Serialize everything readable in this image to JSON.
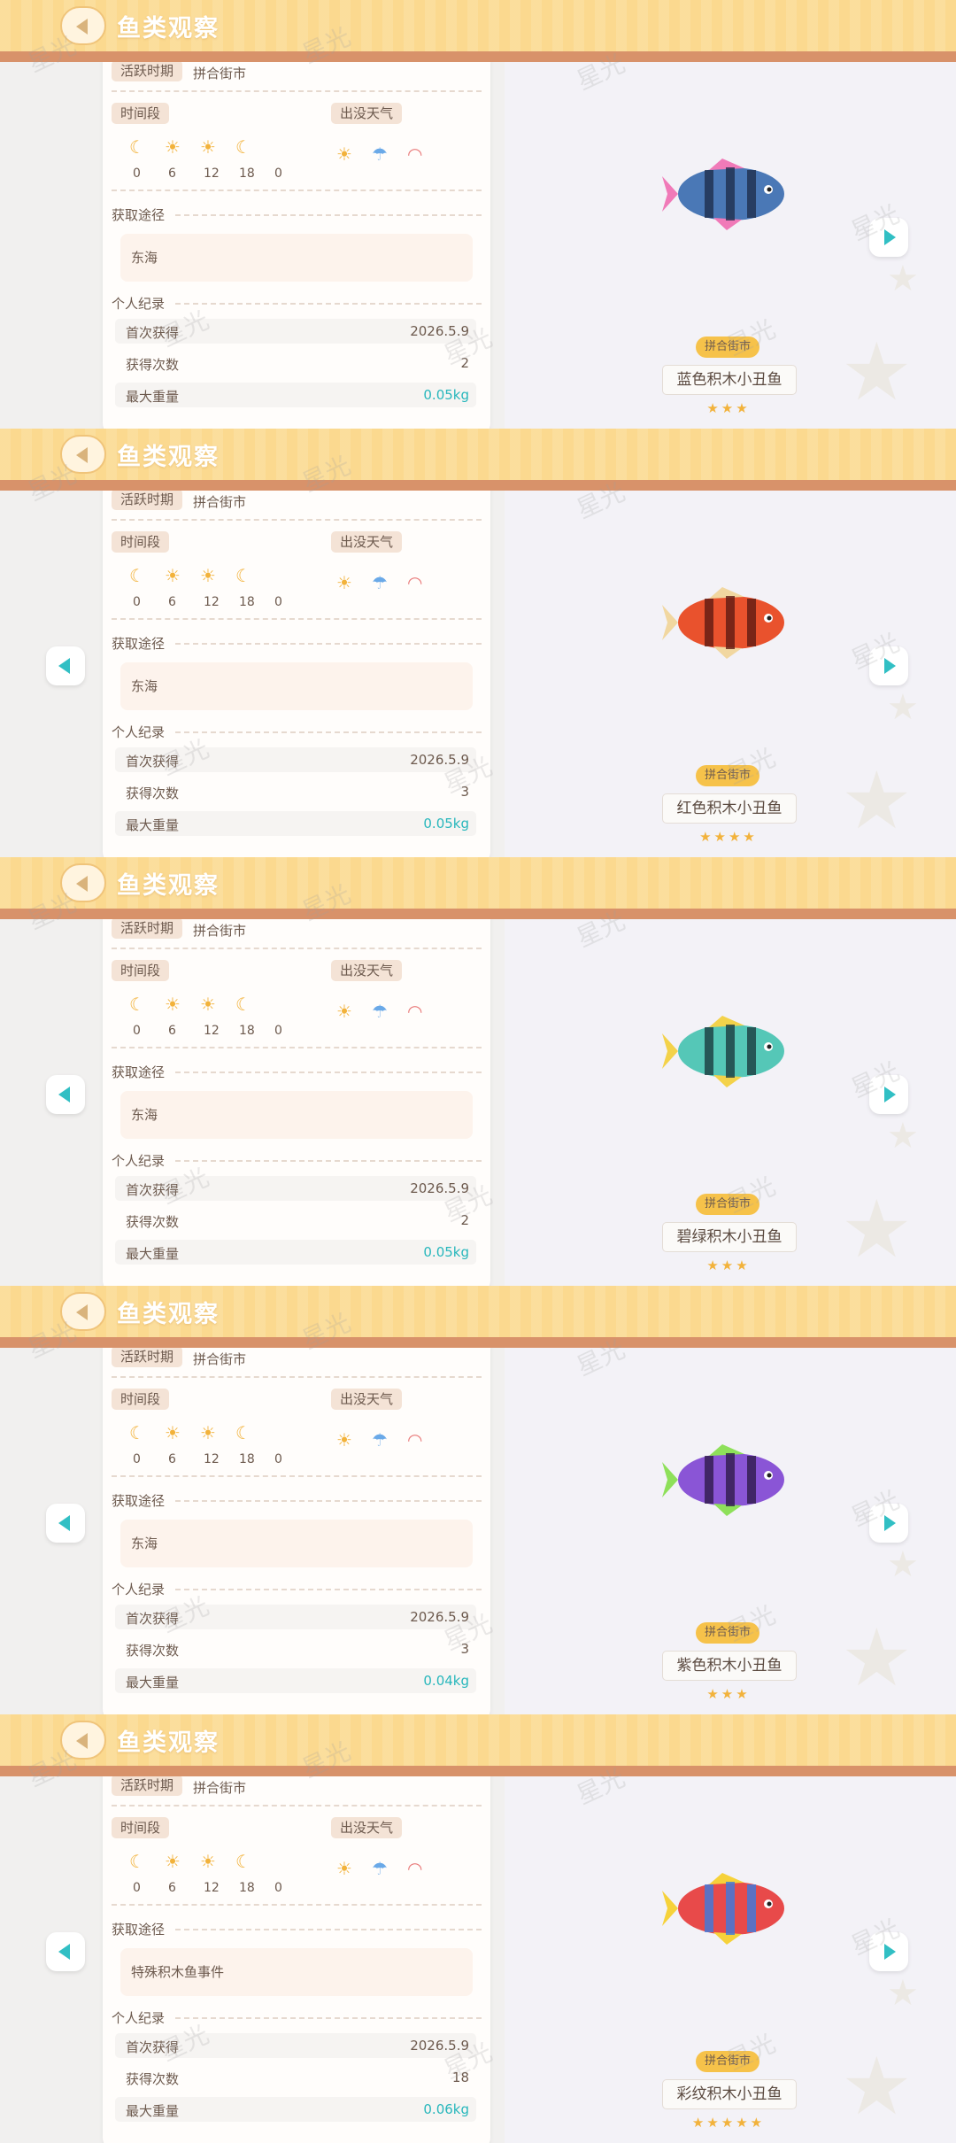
{
  "header": {
    "title": "鱼类观察"
  },
  "labels": {
    "active_period": "活跃时期",
    "time_segment": "时间段",
    "weather": "出没天气",
    "obtain_way": "获取途径",
    "personal_record": "个人纪录",
    "first_obtained": "首次获得",
    "obtain_count": "获得次数",
    "max_weight": "最大重量"
  },
  "time_ticks": [
    "0",
    "6",
    "12",
    "18",
    "0"
  ],
  "time_icons": [
    "moon-icon",
    "sunrise-icon",
    "sun-icon",
    "moon-icon"
  ],
  "weather_icons": [
    "sun-icon",
    "rain-cloud-icon",
    "rainbow-icon"
  ],
  "watermark": "星光",
  "colors": {
    "header": "#fbd98f",
    "stripe": "#d8926a",
    "teal": "#28b7bc",
    "star": "#f2b23b",
    "badge": "#f6c24a"
  },
  "panels": [
    {
      "season": "拼合街市",
      "source": "东海",
      "first": "2026.5.9",
      "count": "2",
      "weight": "0.05kg",
      "location": "拼合街市",
      "name": "蓝色积木小丑鱼",
      "stars": "★★★",
      "fish_colors": [
        "#4a78b6",
        "#1e2e4e",
        "#f07ab8"
      ],
      "has_left": false
    },
    {
      "season": "拼合街市",
      "source": "东海",
      "first": "2026.5.9",
      "count": "3",
      "weight": "0.05kg",
      "location": "拼合街市",
      "name": "红色积木小丑鱼",
      "stars": "★★★★",
      "fish_colors": [
        "#e9522d",
        "#5e1a12",
        "#f1d7a0"
      ],
      "has_left": true
    },
    {
      "season": "拼合街市",
      "source": "东海",
      "first": "2026.5.9",
      "count": "2",
      "weight": "0.05kg",
      "location": "拼合街市",
      "name": "碧绿积木小丑鱼",
      "stars": "★★★",
      "fish_colors": [
        "#55c7b7",
        "#1a3b3f",
        "#f3d24a"
      ],
      "has_left": true
    },
    {
      "season": "拼合街市",
      "source": "东海",
      "first": "2026.5.9",
      "count": "3",
      "weight": "0.04kg",
      "location": "拼合街市",
      "name": "紫色积木小丑鱼",
      "stars": "★★★",
      "fish_colors": [
        "#8a55d6",
        "#2e1a4a",
        "#8ee05a"
      ],
      "has_left": true
    },
    {
      "season": "拼合街市",
      "source": "特殊积木鱼事件",
      "first": "2026.5.9",
      "count": "18",
      "weight": "0.06kg",
      "location": "拼合街市",
      "name": "彩纹积木小丑鱼",
      "stars": "★★★★★",
      "fish_colors": [
        "#e84a4a",
        "#3a7be0",
        "#f6d23a"
      ],
      "has_left": true
    }
  ]
}
